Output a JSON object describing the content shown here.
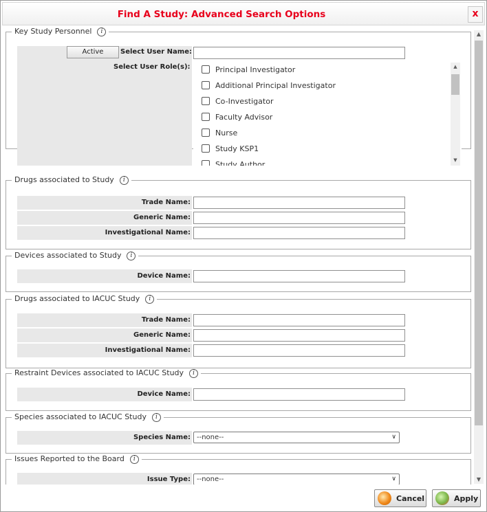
{
  "dialog": {
    "title": "Find A Study: Advanced Search Options",
    "close_label": "x"
  },
  "ksp": {
    "legend": "Key Study Personnel",
    "active_button": "Active",
    "user_name_label": "Select User Name:",
    "user_role_label": "Select User Role(s):",
    "roles": [
      "Principal Investigator",
      "Additional Principal Investigator",
      "Co-Investigator",
      "Faculty Advisor",
      "Nurse",
      "Study KSP1",
      "Study Author"
    ]
  },
  "drugs": {
    "legend": "Drugs associated to Study",
    "trade": "Trade Name:",
    "generic": "Generic Name:",
    "investigational": "Investigational Name:"
  },
  "devices": {
    "legend": "Devices associated to Study",
    "device": "Device Name:"
  },
  "iacuc_drugs": {
    "legend": "Drugs associated to IACUC Study",
    "trade": "Trade Name:",
    "generic": "Generic Name:",
    "investigational": "Investigational Name:"
  },
  "restraint": {
    "legend": "Restraint Devices associated to IACUC Study",
    "device": "Device Name:"
  },
  "species": {
    "legend": "Species associated to IACUC Study",
    "label": "Species Name:",
    "value": "--none--"
  },
  "issues": {
    "legend": "Issues Reported to the Board",
    "label": "Issue Type:",
    "value": "--none--"
  },
  "footer": {
    "cancel": "Cancel",
    "apply": "Apply"
  },
  "colors": {
    "title": "#e8001c",
    "label_bg": "#e8e8e8",
    "cancel_icon": "#f08a1c",
    "apply_icon": "#7ab648"
  },
  "icons": {
    "info": "info-icon",
    "close": "close-icon",
    "cancel": "cancel-icon",
    "apply": "apply-icon",
    "dropdown": "chevron-down-icon"
  }
}
